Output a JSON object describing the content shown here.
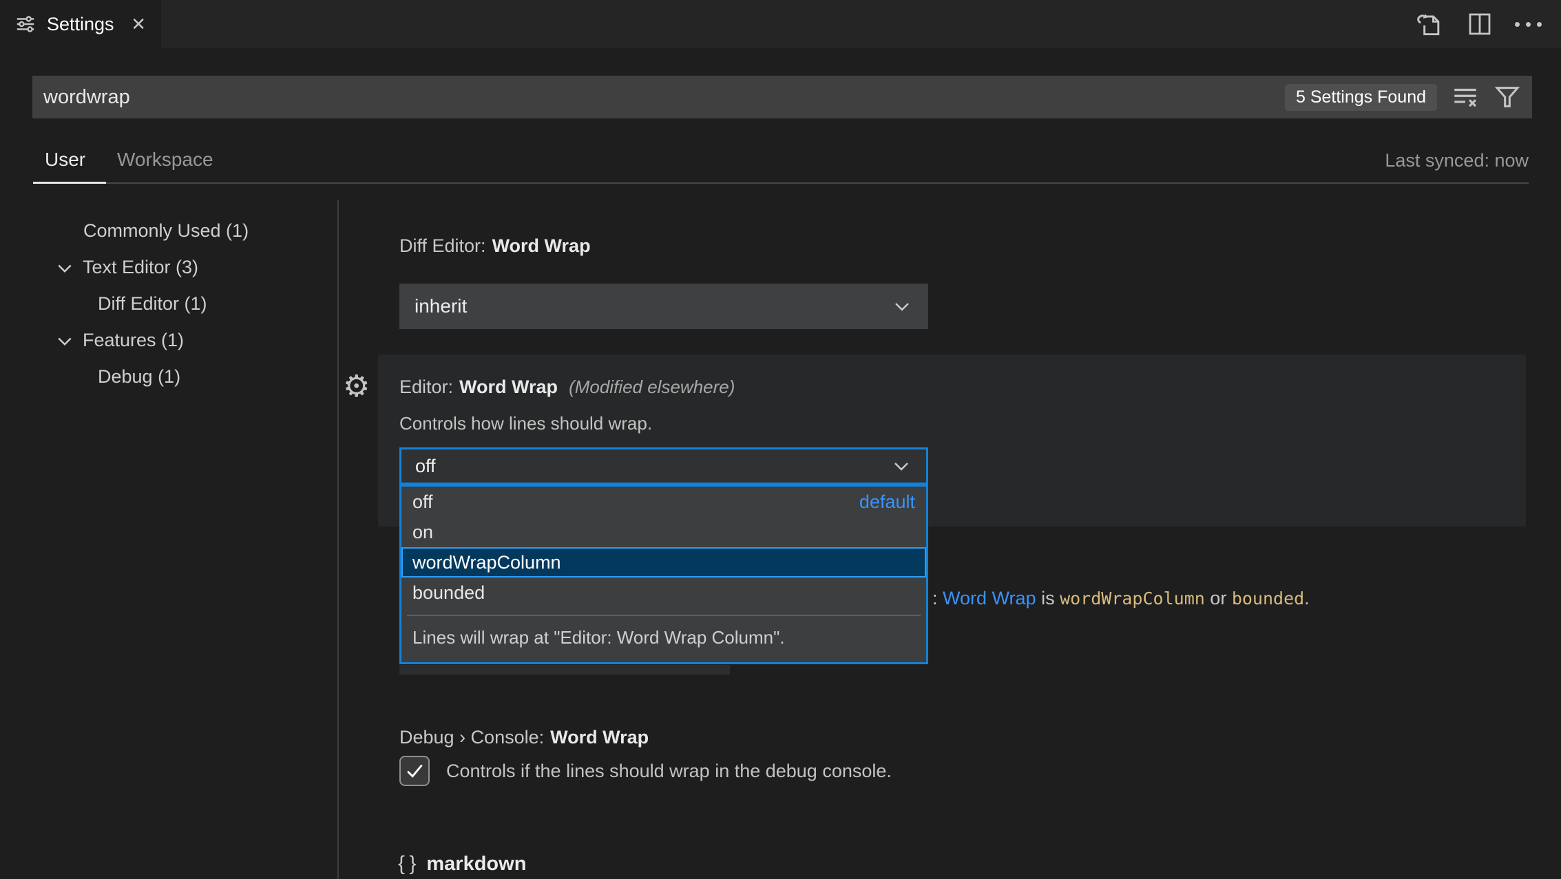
{
  "tab_bar": {
    "title": "Settings",
    "close_label": "✕",
    "actions": [
      "open-settings-json-icon",
      "split-editor-icon",
      "more-actions-icon"
    ]
  },
  "search": {
    "value": "wordwrap",
    "results_badge": "5 Settings Found",
    "icons": [
      "clear-settings-search-icon",
      "filter-icon"
    ]
  },
  "scope": {
    "user_tab": "User",
    "workspace_tab": "Workspace",
    "last_synced": "Last synced: now"
  },
  "toc": {
    "items": [
      {
        "text": "Commonly Used (1)",
        "chevron": false,
        "indent": 1
      },
      {
        "text": "Text Editor (3)",
        "chevron": true,
        "indent": 1
      },
      {
        "text": "Diff Editor (1)",
        "chevron": false,
        "indent": 2
      },
      {
        "text": "Features (1)",
        "chevron": true,
        "indent": 1
      },
      {
        "text": "Debug (1)",
        "chevron": false,
        "indent": 2
      }
    ]
  },
  "settings": {
    "diff_editor_word_wrap": {
      "category": "Diff Editor:",
      "label": "Word Wrap",
      "value": "inherit"
    },
    "editor_word_wrap": {
      "category": "Editor:",
      "label": "Word Wrap",
      "modified_note": "(Modified elsewhere)",
      "description": "Controls how lines should wrap.",
      "value": "off",
      "dropdown": {
        "options": [
          {
            "label": "off",
            "tag": "default"
          },
          {
            "label": "on",
            "tag": ""
          },
          {
            "label": "wordWrapColumn",
            "tag": ""
          },
          {
            "label": "bounded",
            "tag": ""
          }
        ],
        "selected_option": "wordWrapColumn",
        "description": "Lines will wrap at \"Editor: Word Wrap Column\"."
      }
    },
    "obscured_text": {
      "prefix": ": ",
      "link": "Word Wrap",
      "mid1": " is ",
      "code1": "wordWrapColumn",
      "mid2": " or ",
      "code2": "bounded",
      "suffix": "."
    },
    "debug_console_word_wrap": {
      "category": "Debug › Console:",
      "label": "Word Wrap",
      "checked": true,
      "description": "Controls if the lines should wrap in the debug console."
    },
    "markdown_section": {
      "icon_text": "{ }",
      "label": "markdown"
    }
  },
  "colors": {
    "focus_border": "#1482d8",
    "link_blue": "#3794ff",
    "code_gold": "#d7ba7d",
    "selected_option_bg": "#04395e",
    "badge_bg": "#4f4f4f"
  }
}
